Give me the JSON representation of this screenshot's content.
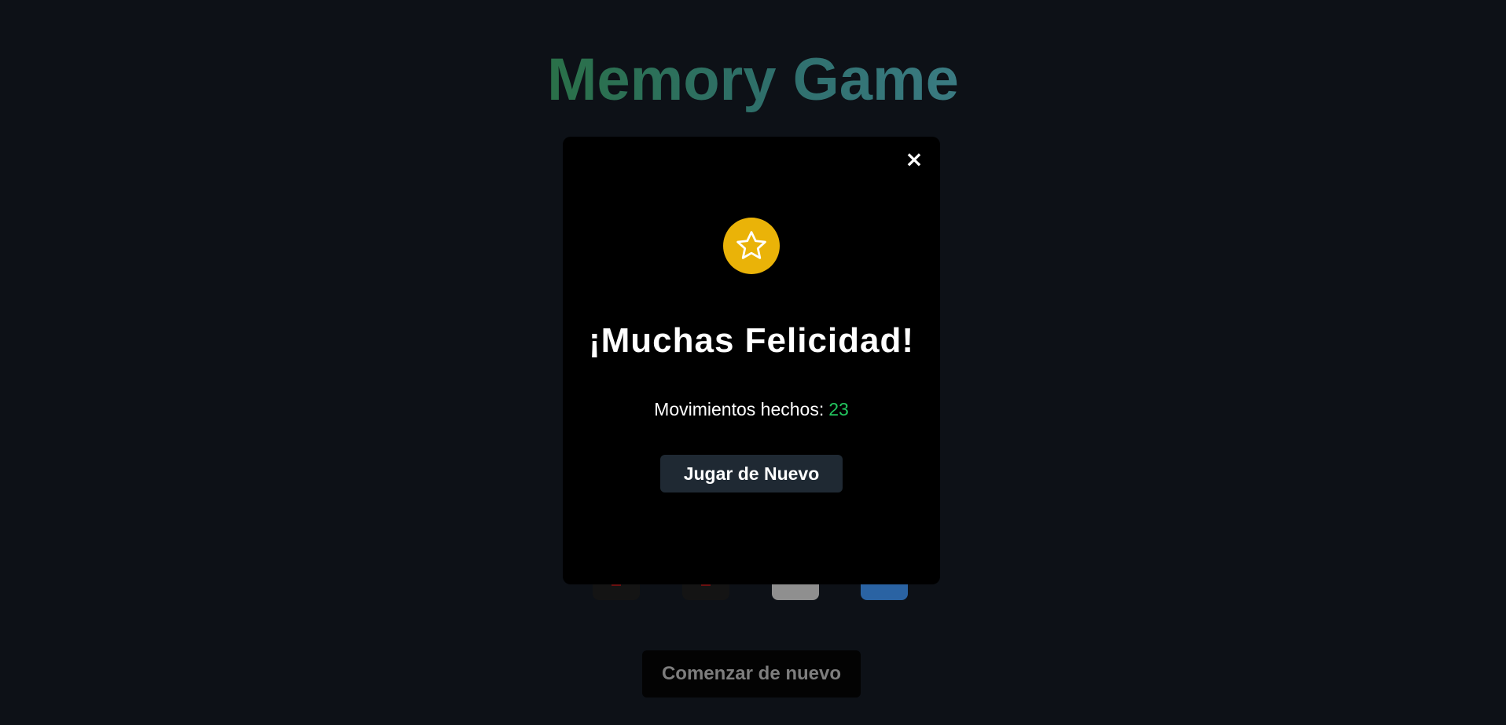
{
  "header": {
    "title": "Memory Game"
  },
  "board": {
    "visible_cards": [
      {
        "icon": "red-logo-card",
        "color": "#141414"
      },
      {
        "icon": "red-logo-card",
        "color": "#141414"
      },
      {
        "icon": "green-logo-card",
        "color": "#8f8f8f"
      },
      {
        "icon": "blue-card",
        "color": "#2a63a3"
      }
    ]
  },
  "controls": {
    "restart_label": "Comenzar de nuevo"
  },
  "modal": {
    "close_symbol": "×",
    "icon": "star-icon",
    "badge_color": "#eab308",
    "title": "¡Muchas Felicidad!",
    "moves_label": "Movimientos hechos:",
    "moves_count": "23",
    "moves_count_color": "#22c55e",
    "play_again_label": "Jugar de Nuevo"
  }
}
